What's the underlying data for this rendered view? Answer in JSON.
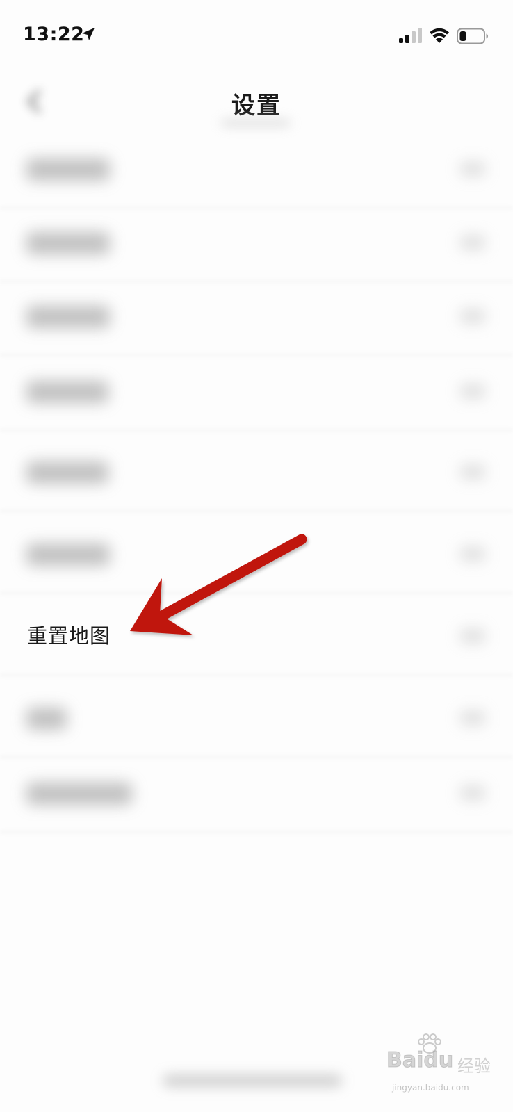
{
  "status_bar": {
    "time": "13:22",
    "icons": [
      "location-arrow-icon",
      "cellular-signal-icon",
      "wifi-icon",
      "battery-icon"
    ]
  },
  "nav": {
    "title": "设置",
    "back_icon": "back-chevron-icon"
  },
  "settings": {
    "highlighted_label": "重置地图",
    "row_count": 9,
    "row_chevron_icon": "chevron-right-icon"
  },
  "annotation": {
    "arrow_color": "#c0180f"
  },
  "watermark": {
    "brand": "Baidu",
    "cn": "经验",
    "url": "jingyan.baidu.com"
  },
  "colors": {
    "background": "#fdfdfd",
    "text": "#1a1a1a",
    "arrow": "#c0180f"
  }
}
